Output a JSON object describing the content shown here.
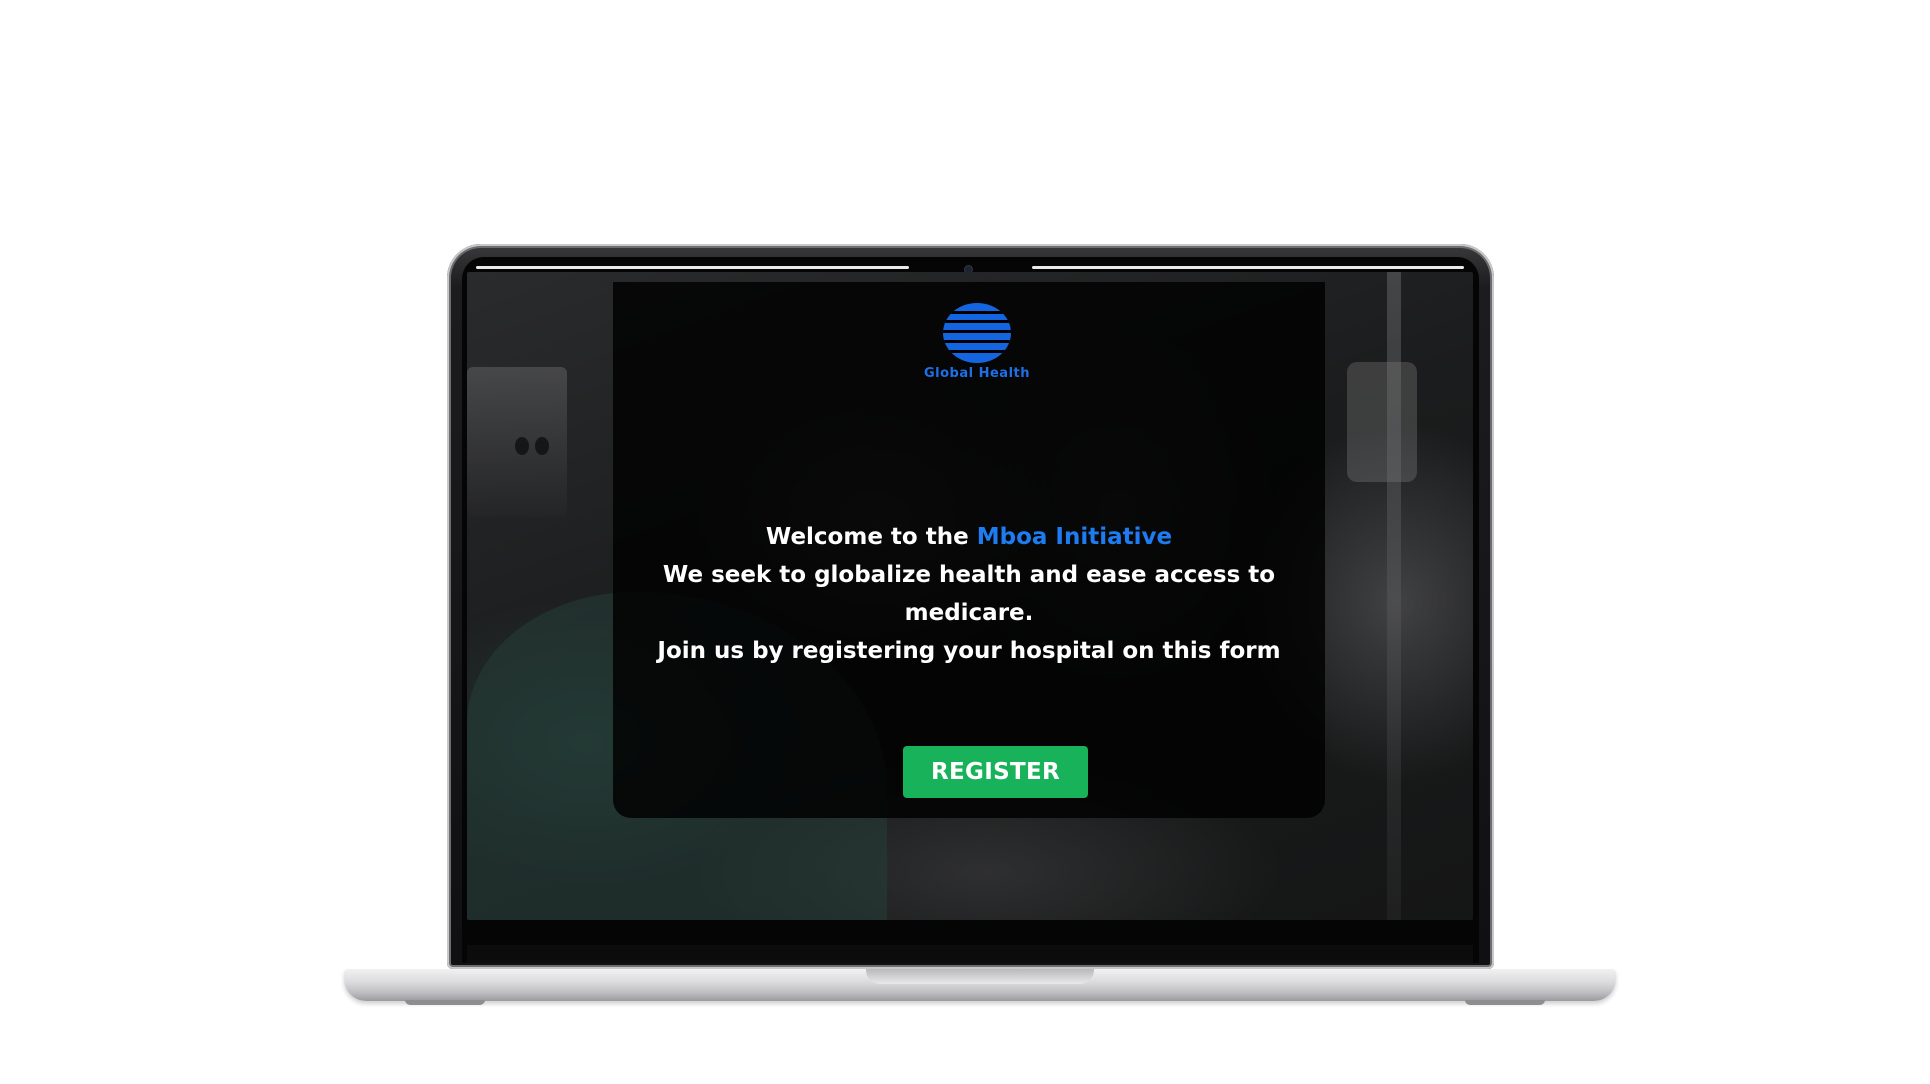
{
  "logo": {
    "text": "Global Health"
  },
  "hero": {
    "welcome_prefix": "Welcome to the ",
    "welcome_accent": "Mboa Initiative",
    "line2": "We seek to globalize health and ease access to medicare.",
    "line3": "Join us by registering your hospital on this  form"
  },
  "actions": {
    "register_label": "REGISTER"
  },
  "colors": {
    "accent_blue": "#1e7cf2",
    "register_green": "#18b25a",
    "overlay": "#000000"
  }
}
